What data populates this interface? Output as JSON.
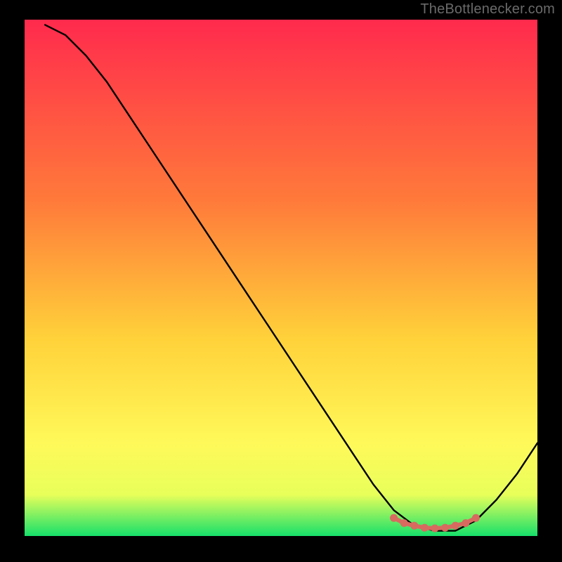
{
  "attribution": "TheBottlenecker.com",
  "chart_data": {
    "type": "line",
    "title": "",
    "xlabel": "",
    "ylabel": "",
    "xlim": [
      0,
      100
    ],
    "ylim": [
      0,
      100
    ],
    "gradient_colors": {
      "top": "#ff2a4d",
      "mid1": "#ff7a3a",
      "mid2": "#ffd23a",
      "mid3": "#fff95a",
      "mid4": "#e8ff5a",
      "bottom": "#16e06a"
    },
    "series": [
      {
        "name": "curve",
        "color": "#000000",
        "x": [
          4,
          8,
          12,
          16,
          20,
          24,
          28,
          32,
          36,
          40,
          44,
          48,
          52,
          56,
          60,
          64,
          68,
          72,
          76,
          80,
          84,
          88,
          92,
          96,
          100
        ],
        "y": [
          100,
          97,
          93,
          88,
          82,
          76,
          70,
          64,
          58,
          52,
          46,
          40,
          34,
          28,
          22,
          16,
          10,
          5,
          2,
          1,
          1,
          3,
          7,
          12,
          18
        ]
      },
      {
        "name": "valley-highlight",
        "color": "#d86a60",
        "x": [
          72,
          74,
          76,
          78,
          80,
          82,
          84,
          86,
          88
        ],
        "y": [
          3.5,
          2.5,
          2.0,
          1.6,
          1.5,
          1.6,
          2.0,
          2.5,
          3.5
        ]
      }
    ]
  }
}
